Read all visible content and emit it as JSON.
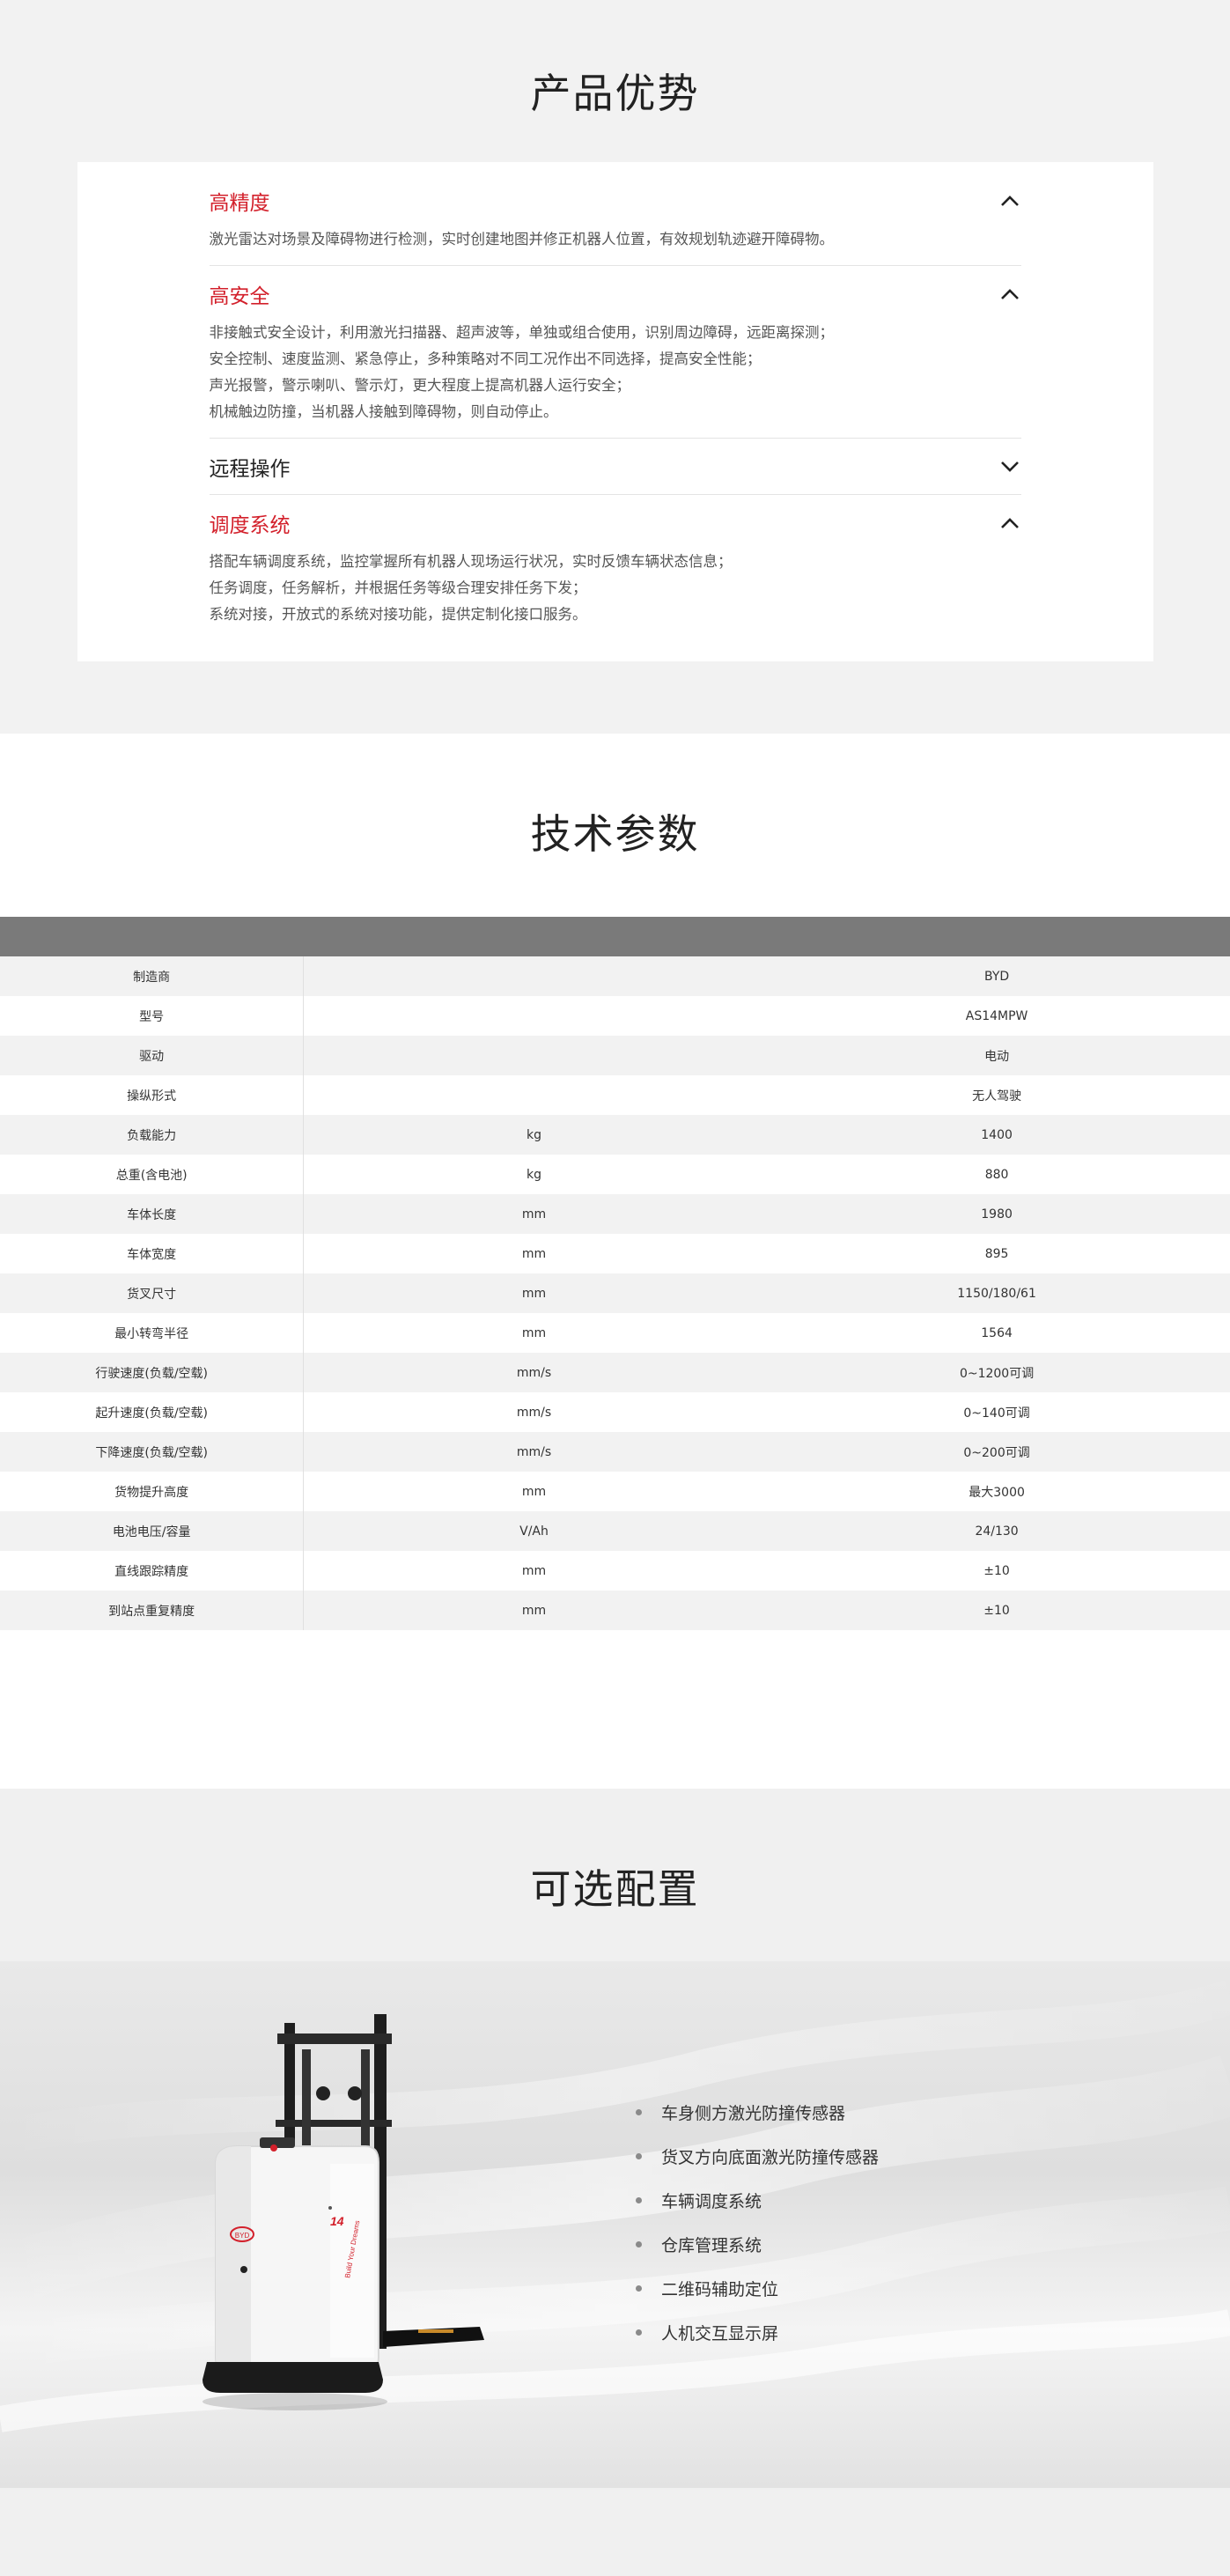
{
  "advantages": {
    "title": "产品优势",
    "items": [
      {
        "title": "高精度",
        "open": true,
        "lines": [
          "激光雷达对场景及障碍物进行检测，实时创建地图并修正机器人位置，有效规划轨迹避开障碍物。"
        ]
      },
      {
        "title": "高安全",
        "open": true,
        "lines": [
          "非接触式安全设计，利用激光扫描器、超声波等，单独或组合使用，识别周边障碍，远距离探测；",
          "安全控制、速度监测、紧急停止，多种策略对不同工况作出不同选择，提高安全性能；",
          "声光报警，警示喇叭、警示灯，更大程度上提高机器人运行安全；",
          "机械触边防撞，当机器人接触到障碍物，则自动停止。"
        ]
      },
      {
        "title": "远程操作",
        "open": false,
        "lines": []
      },
      {
        "title": "调度系统",
        "open": true,
        "lines": [
          "搭配车辆调度系统，监控掌握所有机器人现场运行状况，实时反馈车辆状态信息；",
          "任务调度，任务解析，并根据任务等级合理安排任务下发；",
          "系统对接，开放式的系统对接功能，提供定制化接口服务。"
        ]
      }
    ]
  },
  "specs": {
    "title": "技术参数",
    "rows": [
      {
        "name": "制造商",
        "unit": "",
        "value": "BYD"
      },
      {
        "name": "型号",
        "unit": "",
        "value": "AS14MPW"
      },
      {
        "name": "驱动",
        "unit": "",
        "value": "电动"
      },
      {
        "name": "操纵形式",
        "unit": "",
        "value": "无人驾驶"
      },
      {
        "name": "负载能力",
        "unit": "kg",
        "value": "1400"
      },
      {
        "name": "总重(含电池)",
        "unit": "kg",
        "value": "880"
      },
      {
        "name": "车体长度",
        "unit": "mm",
        "value": "1980"
      },
      {
        "name": "车体宽度",
        "unit": "mm",
        "value": "895"
      },
      {
        "name": "货叉尺寸",
        "unit": "mm",
        "value": "1150/180/61"
      },
      {
        "name": "最小转弯半径",
        "unit": "mm",
        "value": "1564"
      },
      {
        "name": "行驶速度(负载/空载)",
        "unit": "mm/s",
        "value": "0~1200可调"
      },
      {
        "name": "起升速度(负载/空载)",
        "unit": "mm/s",
        "value": "0~140可调"
      },
      {
        "name": "下降速度(负载/空载)",
        "unit": "mm/s",
        "value": "0~200可调"
      },
      {
        "name": "货物提升高度",
        "unit": "mm",
        "value": "最大3000"
      },
      {
        "name": "电池电压/容量",
        "unit": "V/Ah",
        "value": "24/130"
      },
      {
        "name": "直线跟踪精度",
        "unit": "mm",
        "value": "±10"
      },
      {
        "name": "到站点重复精度",
        "unit": "mm",
        "value": "±10"
      }
    ]
  },
  "options": {
    "title": "可选配置",
    "items": [
      "车身侧方激光防撞传感器",
      "货叉方向底面激光防撞传感器",
      "车辆调度系统",
      "仓库管理系统",
      "二维码辅助定位",
      "人机交互显示屏"
    ],
    "forklift_model_label": "14",
    "forklift_brand": "BYD",
    "forklift_slogan": "Build Your Dreams"
  },
  "colors": {
    "accent": "#d3202b",
    "table_header": "#7a7a7a",
    "row_alt": "#f2f2f2"
  }
}
